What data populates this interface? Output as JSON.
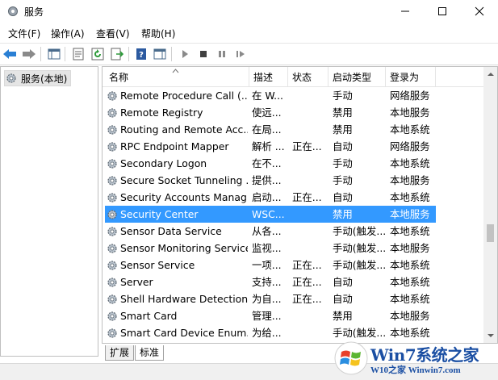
{
  "window": {
    "title": "服务",
    "colors": {
      "selection": "#3399ff",
      "accent": "#1b4fa3"
    }
  },
  "menu": [
    "文件(F)",
    "操作(A)",
    "查看(V)",
    "帮助(H)"
  ],
  "toolbar": {
    "icons": [
      "back-arrow-icon",
      "forward-arrow-icon",
      "show-hide-console-tree-icon",
      "properties-icon",
      "refresh-icon",
      "export-list-icon",
      "help-icon",
      "show-action-pane-icon",
      "play-icon",
      "stop-icon",
      "pause-icon",
      "resume-icon"
    ]
  },
  "tree": {
    "root_label": "服务(本地)"
  },
  "table": {
    "columns": [
      "名称",
      "描述",
      "状态",
      "启动类型",
      "登录为"
    ],
    "rows": [
      {
        "name": "Remote Procedure Call (...",
        "desc": "在 W...",
        "status": "",
        "startup": "手动",
        "logon": "网络服务"
      },
      {
        "name": "Remote Registry",
        "desc": "使远...",
        "status": "",
        "startup": "禁用",
        "logon": "本地服务"
      },
      {
        "name": "Routing and Remote Acc...",
        "desc": "在局...",
        "status": "",
        "startup": "禁用",
        "logon": "本地系统"
      },
      {
        "name": "RPC Endpoint Mapper",
        "desc": "解析 ...",
        "status": "正在...",
        "startup": "自动",
        "logon": "网络服务"
      },
      {
        "name": "Secondary Logon",
        "desc": "在不...",
        "status": "",
        "startup": "手动",
        "logon": "本地系统"
      },
      {
        "name": "Secure Socket Tunneling ...",
        "desc": "提供...",
        "status": "",
        "startup": "手动",
        "logon": "本地服务"
      },
      {
        "name": "Security Accounts Manag...",
        "desc": "启动...",
        "status": "正在...",
        "startup": "自动",
        "logon": "本地系统"
      },
      {
        "name": "Security Center",
        "desc": "WSC...",
        "status": "",
        "startup": "禁用",
        "logon": "本地服务",
        "selected": true
      },
      {
        "name": "Sensor Data Service",
        "desc": "从各...",
        "status": "",
        "startup": "手动(触发...",
        "logon": "本地系统"
      },
      {
        "name": "Sensor Monitoring Service",
        "desc": "监视...",
        "status": "",
        "startup": "手动(触发...",
        "logon": "本地服务"
      },
      {
        "name": "Sensor Service",
        "desc": "一项...",
        "status": "正在...",
        "startup": "手动(触发...",
        "logon": "本地系统"
      },
      {
        "name": "Server",
        "desc": "支持...",
        "status": "正在...",
        "startup": "自动",
        "logon": "本地系统"
      },
      {
        "name": "Shell Hardware Detection",
        "desc": "为自...",
        "status": "正在...",
        "startup": "自动",
        "logon": "本地系统"
      },
      {
        "name": "Smart Card",
        "desc": "管理...",
        "status": "",
        "startup": "禁用",
        "logon": "本地服务"
      },
      {
        "name": "Smart Card Device Enum...",
        "desc": "为给...",
        "status": "",
        "startup": "手动(触发...",
        "logon": "本地系统"
      }
    ]
  },
  "tabs": [
    "扩展",
    "标准"
  ],
  "watermark": {
    "line1": "Win7系统之家",
    "line2": "W10之家 Winwin7.com"
  }
}
